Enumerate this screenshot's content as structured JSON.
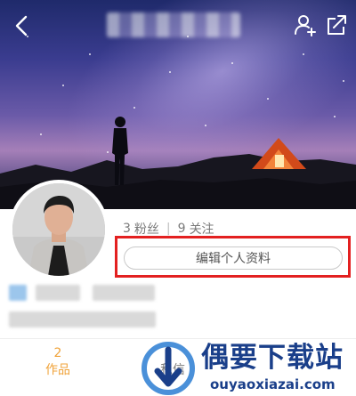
{
  "header": {
    "back_icon": "chevron-left-icon",
    "add_user_icon": "add-user-icon",
    "share_icon": "share-icon"
  },
  "profile": {
    "fans_count": "3",
    "fans_label": "粉丝",
    "divider": "|",
    "following_count": "9",
    "following_label": "关注",
    "edit_button_label": "编辑个人资料"
  },
  "tabs": {
    "works_count": "2",
    "works_label": "作品",
    "message_label": "私信"
  },
  "watermark": {
    "brand": "偶要下载站",
    "url": "ouyaoxiazai.com"
  },
  "colors": {
    "accent_orange": "#f0a33a",
    "highlight_red": "#e32020",
    "watermark_blue": "#1a3f8a"
  }
}
